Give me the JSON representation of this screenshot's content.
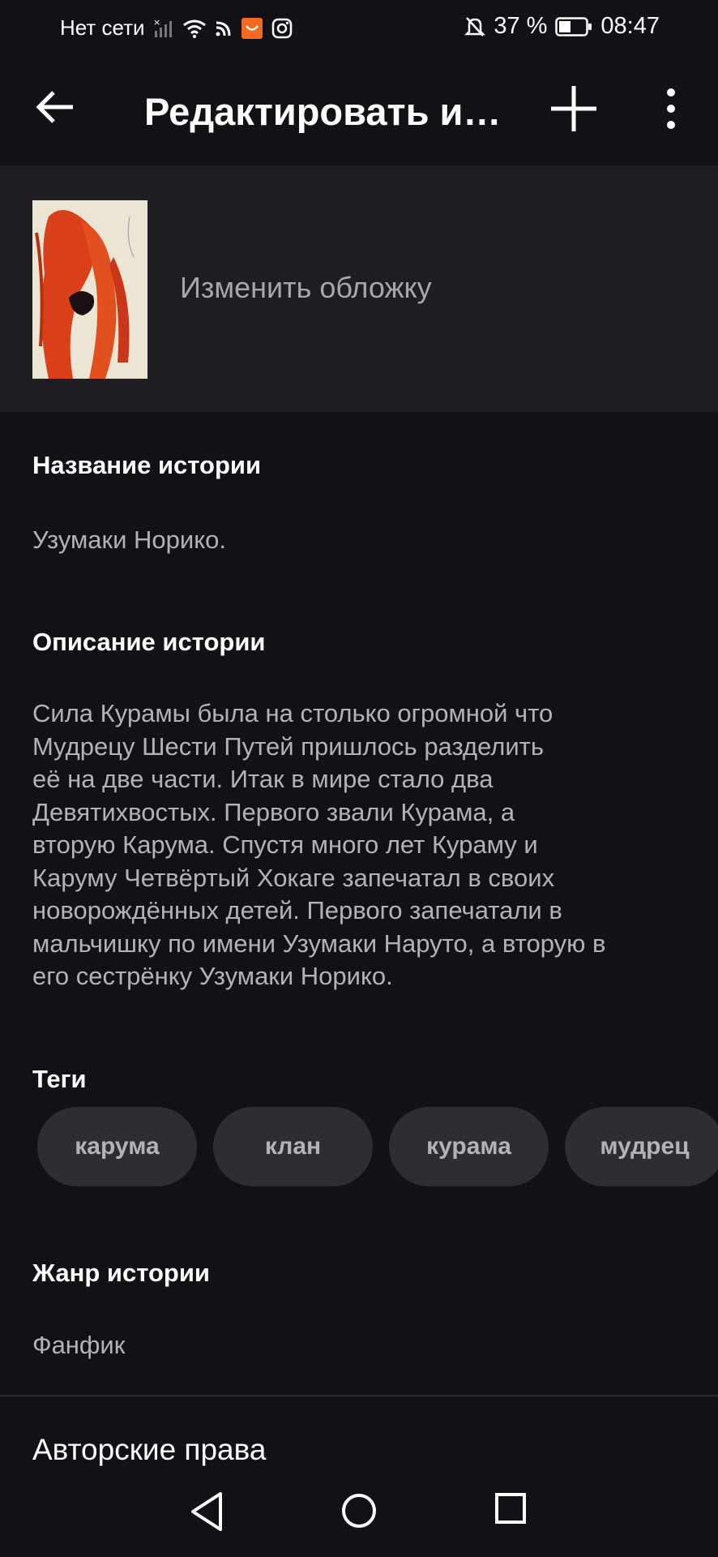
{
  "status_bar": {
    "network": "Нет сети",
    "battery": "37 %",
    "time": "08:47"
  },
  "app_bar": {
    "title": "Редактировать и…",
    "icons": [
      "back-arrow-icon",
      "plus-icon",
      "more-vert-icon"
    ]
  },
  "cover": {
    "change_label": "Изменить обложку"
  },
  "story": {
    "title_label": "Название истории",
    "title_value": "Узумаки Норико.",
    "description_label": "Описание истории",
    "description_value": "Сила Курамы была на столько огромной что\nМудрецу Шести Путей пришлось разделить\nеё на две части. Итак в мире стало два\nДевятихвостых. Первого звали Курама, а\nвторую Карума. Спустя много лет Кураму и\nКаруму Четвёртый Хокаге запечатал в своих\nноворождённых детей. Первого запечатали в\nмальчишку по имени Узумаки Наруто, а вторую в\nего сестрёнку Узумаки Норико.",
    "tags_label": "Теги",
    "tags": [
      "карума",
      "клан",
      "курама",
      "мудрец"
    ],
    "genre_label": "Жанр истории",
    "genre_value": "Фанфик",
    "copyright_label": "Авторские права"
  },
  "colors": {
    "background": "#121115",
    "cover_section": "#1e1d21",
    "tag_bg": "#2e2d32",
    "secondary_text": "#b4b2b7"
  }
}
